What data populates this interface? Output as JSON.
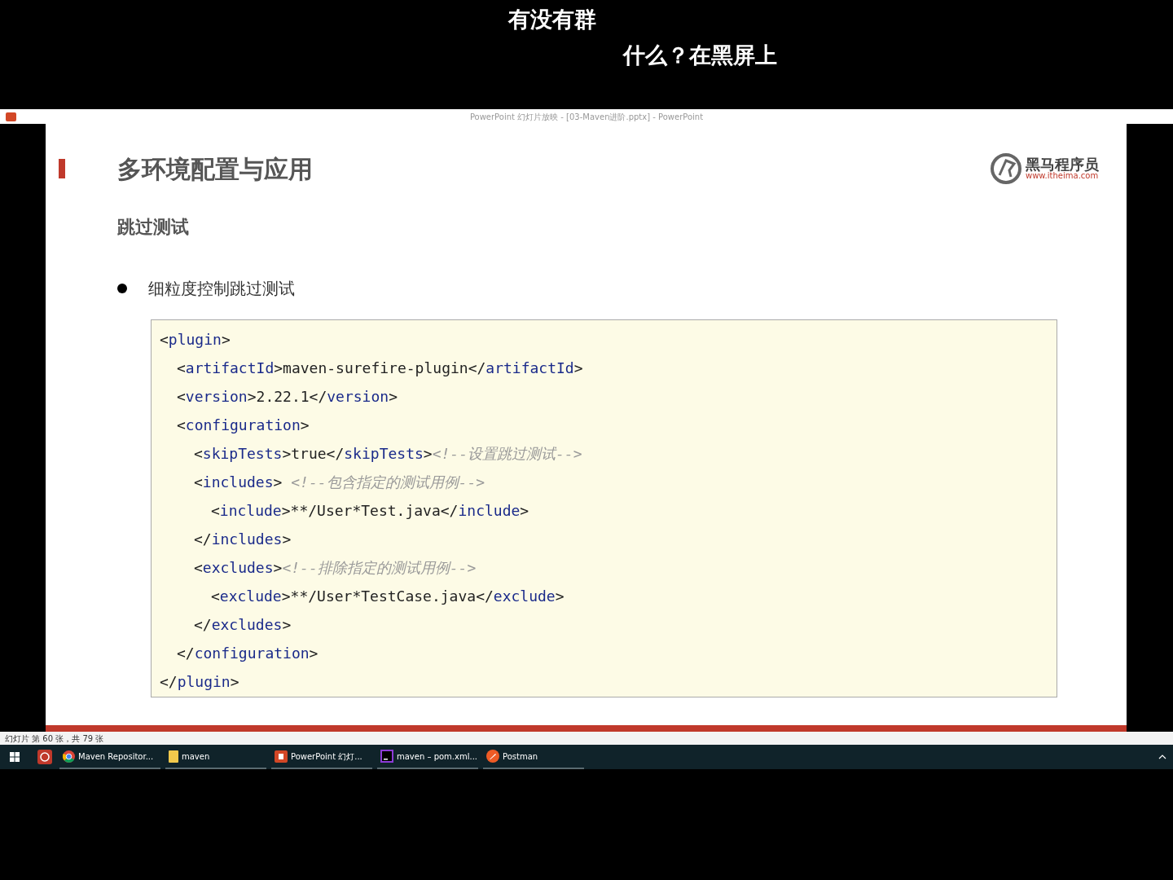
{
  "comments": [
    {
      "text": "有没有群"
    },
    {
      "text": "什么？在黑屏上"
    }
  ],
  "window": {
    "title": "PowerPoint 幻灯片放映 - [03-Maven进阶.pptx] - PowerPoint"
  },
  "slide": {
    "title": "多环境配置与应用",
    "logo": {
      "name": "黑马程序员",
      "url": "www.itheima.com"
    },
    "subtitle": "跳过测试",
    "bullet": "细粒度控制跳过测试",
    "code": [
      {
        "tokens": [
          {
            "kind": "punct",
            "text": "<"
          },
          {
            "kind": "tag",
            "text": "plugin"
          },
          {
            "kind": "punct",
            "text": ">"
          }
        ],
        "children": [
          {
            "tokens": [
              {
                "kind": "punct",
                "text": "<"
              },
              {
                "kind": "tag",
                "text": "artifactId"
              },
              {
                "kind": "punct",
                "text": ">"
              },
              {
                "kind": "value",
                "text": "maven-surefire-plugin"
              },
              {
                "kind": "punct",
                "text": "</"
              },
              {
                "kind": "tag",
                "text": "artifactId"
              },
              {
                "kind": "punct",
                "text": ">"
              }
            ]
          },
          {
            "tokens": [
              {
                "kind": "punct",
                "text": "<"
              },
              {
                "kind": "tag",
                "text": "version"
              },
              {
                "kind": "punct",
                "text": ">"
              },
              {
                "kind": "value",
                "text": "2.22.1"
              },
              {
                "kind": "punct",
                "text": "</"
              },
              {
                "kind": "tag",
                "text": "version"
              },
              {
                "kind": "punct",
                "text": ">"
              }
            ]
          },
          {
            "tokens": [
              {
                "kind": "punct",
                "text": "<"
              },
              {
                "kind": "tag",
                "text": "configuration"
              },
              {
                "kind": "punct",
                "text": ">"
              }
            ],
            "children": [
              {
                "tokens": [
                  {
                    "kind": "punct",
                    "text": "<"
                  },
                  {
                    "kind": "tag",
                    "text": "skipTests"
                  },
                  {
                    "kind": "punct",
                    "text": ">"
                  },
                  {
                    "kind": "value",
                    "text": "true"
                  },
                  {
                    "kind": "punct",
                    "text": "</"
                  },
                  {
                    "kind": "tag",
                    "text": "skipTests"
                  },
                  {
                    "kind": "punct",
                    "text": ">"
                  },
                  {
                    "kind": "comment",
                    "text": "<!--设置跳过测试-->"
                  }
                ]
              },
              {
                "tokens": [
                  {
                    "kind": "punct",
                    "text": "<"
                  },
                  {
                    "kind": "tag",
                    "text": "includes"
                  },
                  {
                    "kind": "punct",
                    "text": "> "
                  },
                  {
                    "kind": "comment",
                    "text": "<!--包含指定的测试用例-->"
                  }
                ],
                "children": [
                  {
                    "tokens": [
                      {
                        "kind": "punct",
                        "text": "<"
                      },
                      {
                        "kind": "tag",
                        "text": "include"
                      },
                      {
                        "kind": "punct",
                        "text": ">"
                      },
                      {
                        "kind": "value",
                        "text": "**/User*Test.java"
                      },
                      {
                        "kind": "punct",
                        "text": "</"
                      },
                      {
                        "kind": "tag",
                        "text": "include"
                      },
                      {
                        "kind": "punct",
                        "text": ">"
                      }
                    ]
                  }
                ]
              },
              {
                "tokens": [
                  {
                    "kind": "punct",
                    "text": "</"
                  },
                  {
                    "kind": "tag",
                    "text": "includes"
                  },
                  {
                    "kind": "punct",
                    "text": ">"
                  }
                ]
              },
              {
                "tokens": [
                  {
                    "kind": "punct",
                    "text": "<"
                  },
                  {
                    "kind": "tag",
                    "text": "excludes"
                  },
                  {
                    "kind": "punct",
                    "text": ">"
                  },
                  {
                    "kind": "comment",
                    "text": "<!--排除指定的测试用例-->"
                  }
                ],
                "children": [
                  {
                    "tokens": [
                      {
                        "kind": "punct",
                        "text": "<"
                      },
                      {
                        "kind": "tag",
                        "text": "exclude"
                      },
                      {
                        "kind": "punct",
                        "text": ">"
                      },
                      {
                        "kind": "value",
                        "text": "**/User*TestCase.java"
                      },
                      {
                        "kind": "punct",
                        "text": "</"
                      },
                      {
                        "kind": "tag",
                        "text": "exclude"
                      },
                      {
                        "kind": "punct",
                        "text": ">"
                      }
                    ]
                  }
                ]
              },
              {
                "tokens": [
                  {
                    "kind": "punct",
                    "text": "</"
                  },
                  {
                    "kind": "tag",
                    "text": "excludes"
                  },
                  {
                    "kind": "punct",
                    "text": ">"
                  }
                ]
              }
            ]
          },
          {
            "tokens": [
              {
                "kind": "punct",
                "text": "</"
              },
              {
                "kind": "tag",
                "text": "configuration"
              },
              {
                "kind": "punct",
                "text": ">"
              }
            ]
          }
        ]
      },
      {
        "tokens": [
          {
            "kind": "punct",
            "text": "</"
          },
          {
            "kind": "tag",
            "text": "plugin"
          },
          {
            "kind": "punct",
            "text": ">"
          }
        ]
      }
    ]
  },
  "status_bar": {
    "text": "幻灯片 第 60 张，共 79 张"
  },
  "taskbar": {
    "items": [
      {
        "kind": "chrome",
        "label": "Maven Repositor..."
      },
      {
        "kind": "folder",
        "label": "maven"
      },
      {
        "kind": "powerpoint",
        "label": "PowerPoint 幻灯..."
      },
      {
        "kind": "idea",
        "label": "maven – pom.xml..."
      },
      {
        "kind": "postman",
        "label": "Postman"
      }
    ]
  }
}
